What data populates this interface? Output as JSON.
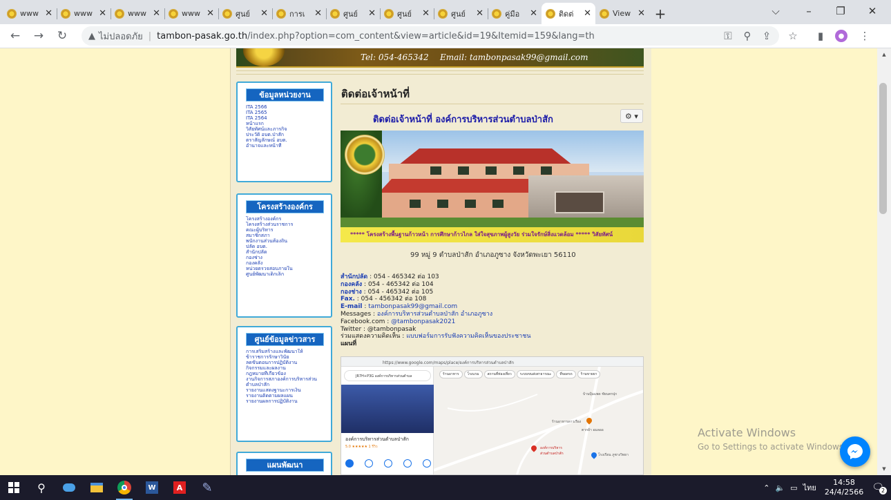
{
  "browser": {
    "tabs": [
      {
        "title": "www"
      },
      {
        "title": "www"
      },
      {
        "title": "www"
      },
      {
        "title": "www"
      },
      {
        "title": "ศูนย์"
      },
      {
        "title": "การเ"
      },
      {
        "title": "ศูนย์"
      },
      {
        "title": "ศูนย์"
      },
      {
        "title": "ศูนย์"
      },
      {
        "title": "คู่มือ"
      },
      {
        "title": "ติดต่"
      },
      {
        "title": "View"
      }
    ],
    "active_tab_index": 10,
    "newtab": "+",
    "security_label": "ไม่ปลอดภัย",
    "url_host": "tambon-pasak.go.th",
    "url_path": "/index.php?option=com_content&view=article&id=19&Itemid=159&lang=th"
  },
  "banner": {
    "tel": "Tel: 054-465342",
    "email": "Email: tambonpasak99@gmail.com"
  },
  "sidebar": {
    "box1": {
      "heading": "ข้อมูลหน่วยงาน",
      "items": [
        "ITA 2566",
        "ITA 2565",
        "ITA 2564",
        "หน้าแรก",
        "วิสัยทัศน์และภารกิจ",
        "ประวัติ อบต.ป่าสัก",
        "ตราสัญลักษณ์ อบต.",
        "อำนาจและหน้าที่"
      ]
    },
    "box2": {
      "heading": "โครงสร้างองค์กร",
      "items": [
        "โครงสร้างองค์กร",
        "โครงสร้างส่วนราชการ",
        "คณะผู้บริหาร",
        "สมาชิกสภา",
        "พนักงานส่วนท้องถิ่น",
        "ปลัด อบต.",
        "สำนักปลัด",
        "กองช่าง",
        "กองคลัง",
        "หน่วยตรวจสอบภายใน",
        "ศูนย์พัฒนาเด็กเล็ก"
      ]
    },
    "box3": {
      "heading": "ศูนย์ข้อมูลข่าวสาร",
      "items": [
        "การเสริมสร้างและพัฒนาให้",
        "ข้าราชการรักษาวินัย",
        "ลดขั้นตอนการปฏิบัติงาน",
        "กิจกรรมและผลงาน",
        "กฎหมายที่เกี่ยวข้อง",
        "งานกิจการสภาองค์การบริหารส่วน",
        "ตำบลป่าสัก",
        "รายงานแสดงฐานะการเงิน",
        "รายงานติดตามผลแผน",
        "รายงานผลการปฏิบัติงาน"
      ]
    },
    "box4": {
      "heading": "แผนพัฒนา"
    }
  },
  "article": {
    "title": "ติดต่อเจ้าหน้าที่",
    "heading": "ติดต่อเจ้าหน้าที่ องค์การบริหารส่วนตำบลป่าสัก",
    "gear": "⚙ ▾",
    "photo_strip": "***** โครงสร้างพื้นฐานก้าวหน้า การศึกษาก้าวไกล ใส่ใจสุขภาพผู้สูงวัย ร่วมใจรักษ์สิ่งแวดล้อม ***** วิสัยทัศน์",
    "address": "99 หมู่ 9 ตำบลป่าสัก อำเภอภูซาง จังหวัดพะเยา 56110",
    "contacts": [
      {
        "label": "สำนักปลัด",
        "value": " : 054 - 465342 ต่อ 103"
      },
      {
        "label": "กองคลัง",
        "value": " : 054 - 465342 ต่อ 104"
      },
      {
        "label": "กองช่าง",
        "value": " : 054 - 465342 ต่อ 105"
      },
      {
        "label": "Fax.",
        "value": " : 054 - 456342 ต่อ 108"
      }
    ],
    "email_label": "E-mail",
    "email_value": "tambonpasak99@gmail.com",
    "messages_label": "Messages : ",
    "messages_value": "องค์การบริหารส่วนตำบลป่าสัก อำเภอภูซาง",
    "facebook_label": "Facebook.com : ",
    "facebook_value": "@tambonpasak2021",
    "twitter": "Twitter : @tambonpasak",
    "feedback_label": "ร่วมแสดงความคิดเห็น : ",
    "feedback_value": "แบบฟอร์มการรับฟังความคิดเห็นของประชาชน",
    "map_label": "แผนที่"
  },
  "map": {
    "url": "https://www.google.com/maps/place/องค์การบริหารส่วนตำบลป่าสัก",
    "search": "JR7H+P3G องค์การบริหารส่วนตำบล",
    "chips": [
      "ร้านอาหาร",
      "โรงแรม",
      "สถานที่ท่องเที่ยว",
      "ระบบขนส่งสาธารณะ",
      "ที่จอดรถ",
      "ร้านขายยา"
    ],
    "place_name": "องค์การบริหารส่วนตำบลป่าสัก",
    "rating": "5.0 ★★★★★ 1 รีวิว",
    "marker_label": "องค์การบริหาร ส่วนตำบลป่าสัก",
    "labels": [
      "บ้านปุ้มแพด ชัยนครปุก",
      "ร้านอาหารดาวเรือง",
      "ตากผ้า อมลออ",
      "โรงเรียน ภูซางวิทยา"
    ]
  },
  "overlay": {
    "activate_title": "Activate Windows",
    "activate_sub": "Go to Settings to activate Windows."
  },
  "taskbar": {
    "time": "14:58",
    "date": "24/4/2566",
    "lang": "ไทย",
    "notifications": "2"
  }
}
